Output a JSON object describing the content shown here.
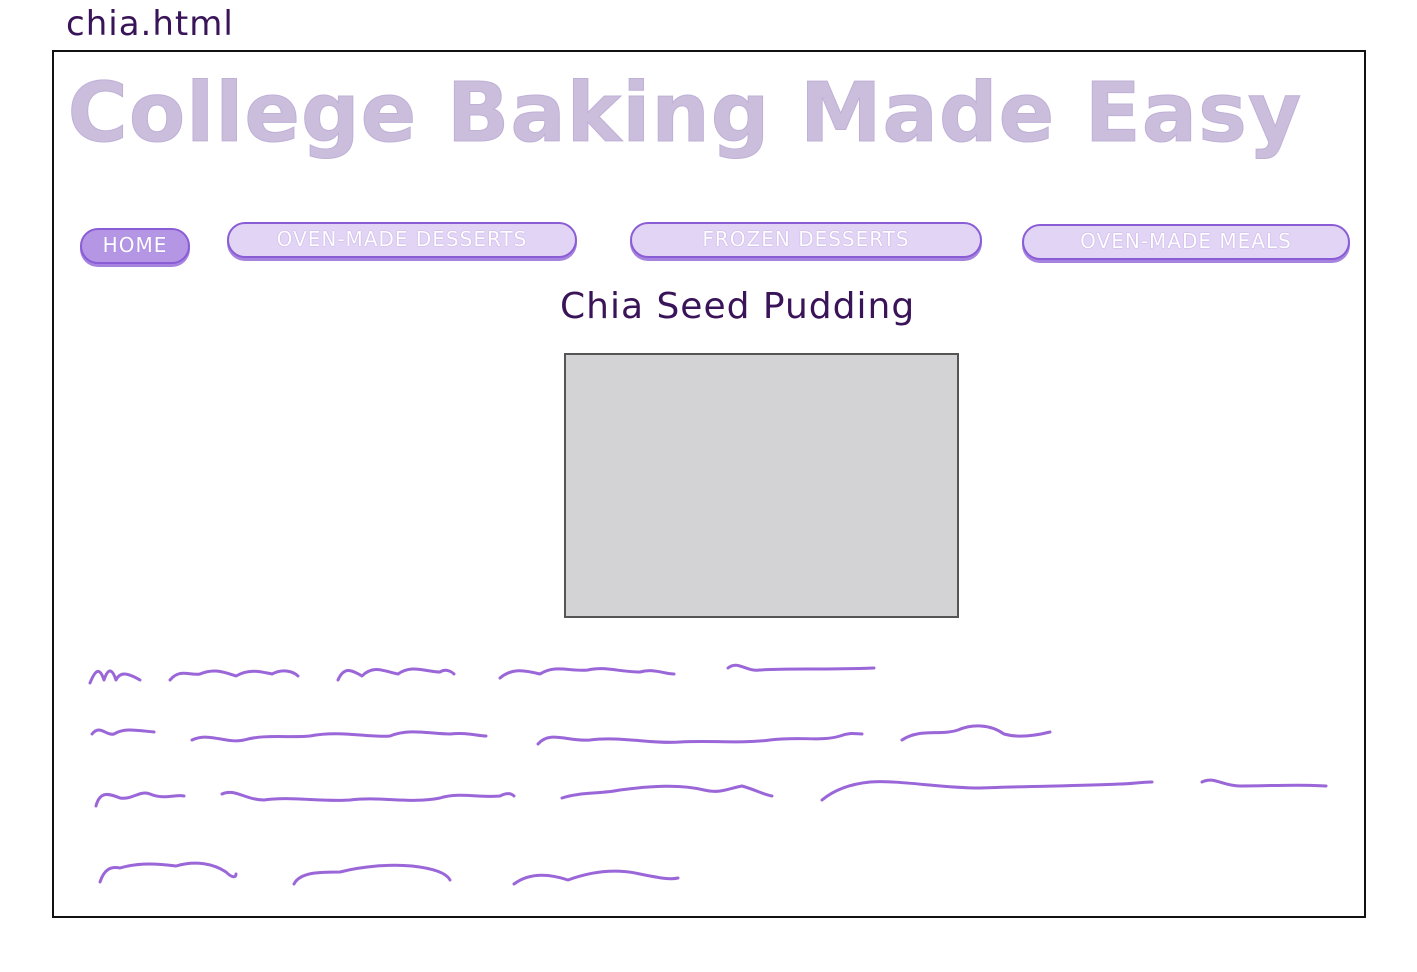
{
  "file_label": "chia.html",
  "header": {
    "site_title": "College Baking Made Easy"
  },
  "nav": {
    "items": [
      {
        "label": "HOME",
        "active": true
      },
      {
        "label": "OVEN-MADE DESSERTS",
        "active": false
      },
      {
        "label": "FROZEN DESSERTS",
        "active": false
      },
      {
        "label": "OVEN-MADE MEALS",
        "active": false
      }
    ]
  },
  "main": {
    "recipe_title": "Chia Seed Pudding",
    "image_placeholder": "image-placeholder"
  },
  "colors": {
    "accent": "#8a5cd6",
    "title": "#cbbedd",
    "nav_fill": "#e2d4f4",
    "text_dark": "#3a1458",
    "placeholder_text_lines": "#9a66d8"
  }
}
